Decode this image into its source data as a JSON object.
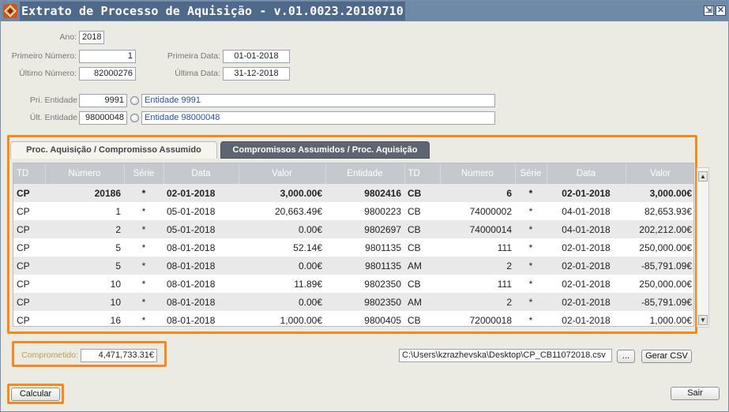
{
  "window": {
    "title": "Extrato de Processo de Aquisição - v.01.0023.20180710"
  },
  "filters": {
    "ano_label": "Ano:",
    "ano_value": "2018",
    "primeiro_numero_label": "Primeiro Número:",
    "primeiro_numero_value": "1",
    "ultimo_numero_label": "Último Número:",
    "ultimo_numero_value": "82000276",
    "primeira_data_label": "Primeira Data:",
    "primeira_data_value": "01-01-2018",
    "ultima_data_label": "Última Data:",
    "ultima_data_value": "31-12-2018",
    "pri_entidade_label": "Pri. Entidade",
    "pri_entidade_value": "9991",
    "pri_entidade_name": "Entidade 9991",
    "ult_entidade_label": "Últ. Entidade",
    "ult_entidade_value": "98000048",
    "ult_entidade_name": "Entidade 98000048"
  },
  "tabs": [
    {
      "label": "Proc. Aquisição / Compromisso Assumido",
      "active": false
    },
    {
      "label": "Compromissos Assumidos / Proc. Aquisição",
      "active": true
    }
  ],
  "table": {
    "headers": [
      "TD",
      "Número",
      "Série",
      "Data",
      "Valor",
      "Entidade",
      "TD",
      "Número",
      "Série",
      "Data",
      "Valor"
    ],
    "rows": [
      [
        "CP",
        "20186",
        "*",
        "02-01-2018",
        "3,000.00€",
        "9802416",
        "CB",
        "6",
        "*",
        "02-01-2018",
        "3,000.00€"
      ],
      [
        "CP",
        "1",
        "*",
        "05-01-2018",
        "20,663.49€",
        "9800223",
        "CB",
        "74000002",
        "*",
        "04-01-2018",
        "82,653.93€"
      ],
      [
        "CP",
        "2",
        "*",
        "05-01-2018",
        "0.00€",
        "9802697",
        "CB",
        "74000014",
        "*",
        "04-01-2018",
        "202,212.00€"
      ],
      [
        "CP",
        "5",
        "*",
        "08-01-2018",
        "52.14€",
        "9801135",
        "CB",
        "111",
        "*",
        "02-01-2018",
        "250,000.00€"
      ],
      [
        "CP",
        "5",
        "*",
        "08-01-2018",
        "0.00€",
        "9801135",
        "AM",
        "2",
        "*",
        "02-01-2018",
        "-85,791.09€"
      ],
      [
        "CP",
        "10",
        "*",
        "08-01-2018",
        "11.89€",
        "9802350",
        "CB",
        "111",
        "*",
        "02-01-2018",
        "250,000.00€"
      ],
      [
        "CP",
        "10",
        "*",
        "08-01-2018",
        "0.00€",
        "9802350",
        "AM",
        "2",
        "*",
        "02-01-2018",
        "-85,791.09€"
      ],
      [
        "CP",
        "16",
        "*",
        "08-01-2018",
        "1,000.00€",
        "9800405",
        "CB",
        "72000018",
        "*",
        "02-01-2018",
        "1,000.00€"
      ]
    ]
  },
  "footer": {
    "comprometido_label": "Comprometido:",
    "comprometido_value": "4,471,733.31€",
    "csv_path": "C:\\Users\\kzrazhevska\\Desktop\\CP_CB11072018.csv",
    "browse_label": "...",
    "gerar_csv_label": "Gerar CSV",
    "calcular_label": "Calcular",
    "sair_label": "Sair"
  },
  "colors": {
    "highlight": "#f28a1e",
    "title_bar": "#6f8aa8",
    "active_tab": "#5d6670"
  }
}
